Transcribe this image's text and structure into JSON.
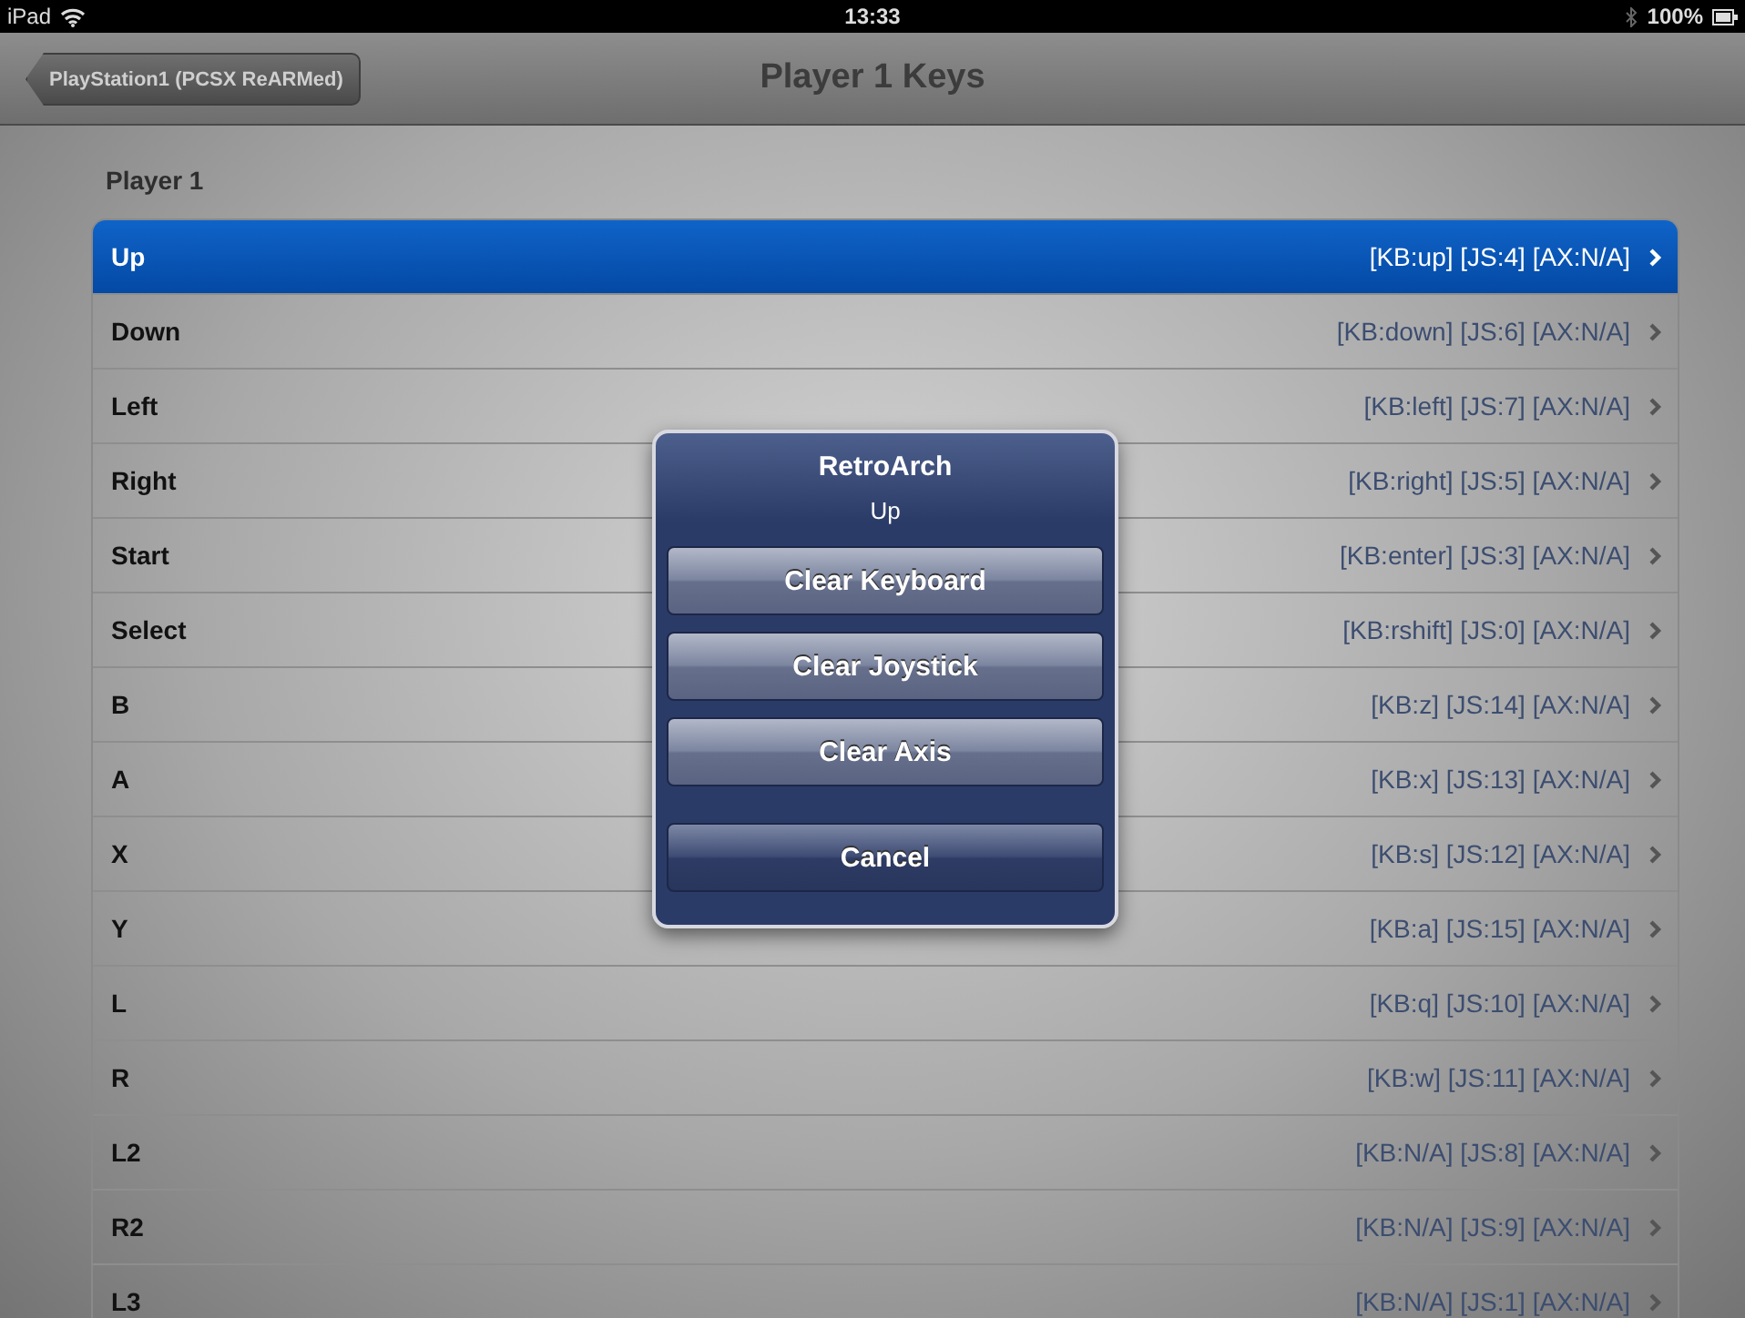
{
  "status_bar": {
    "device": "iPad",
    "time": "13:33",
    "battery": "100%"
  },
  "nav_bar": {
    "back_button": "PlayStation1 (PCSX ReARMed)",
    "title": "Player 1 Keys"
  },
  "section": {
    "header": "Player 1",
    "rows": [
      {
        "label": "Up",
        "value": "[KB:up] [JS:4] [AX:N/A]",
        "selected": true
      },
      {
        "label": "Down",
        "value": "[KB:down] [JS:6] [AX:N/A]",
        "selected": false
      },
      {
        "label": "Left",
        "value": "[KB:left] [JS:7] [AX:N/A]",
        "selected": false
      },
      {
        "label": "Right",
        "value": "[KB:right] [JS:5] [AX:N/A]",
        "selected": false
      },
      {
        "label": "Start",
        "value": "[KB:enter] [JS:3] [AX:N/A]",
        "selected": false
      },
      {
        "label": "Select",
        "value": "[KB:rshift] [JS:0] [AX:N/A]",
        "selected": false
      },
      {
        "label": "B",
        "value": "[KB:z] [JS:14] [AX:N/A]",
        "selected": false
      },
      {
        "label": "A",
        "value": "[KB:x] [JS:13] [AX:N/A]",
        "selected": false
      },
      {
        "label": "X",
        "value": "[KB:s] [JS:12] [AX:N/A]",
        "selected": false
      },
      {
        "label": "Y",
        "value": "[KB:a] [JS:15] [AX:N/A]",
        "selected": false
      },
      {
        "label": "L",
        "value": "[KB:q] [JS:10] [AX:N/A]",
        "selected": false
      },
      {
        "label": "R",
        "value": "[KB:w] [JS:11] [AX:N/A]",
        "selected": false
      },
      {
        "label": "L2",
        "value": "[KB:N/A] [JS:8] [AX:N/A]",
        "selected": false
      },
      {
        "label": "R2",
        "value": "[KB:N/A] [JS:9] [AX:N/A]",
        "selected": false
      },
      {
        "label": "L3",
        "value": "[KB:N/A] [JS:1] [AX:N/A]",
        "selected": false
      }
    ]
  },
  "action_sheet": {
    "title": "RetroArch",
    "message": "Up",
    "buttons": [
      {
        "label": "Clear Keyboard",
        "kind": "action"
      },
      {
        "label": "Clear Joystick",
        "kind": "action"
      },
      {
        "label": "Clear Axis",
        "kind": "action"
      },
      {
        "label": "Cancel",
        "kind": "cancel"
      }
    ]
  }
}
